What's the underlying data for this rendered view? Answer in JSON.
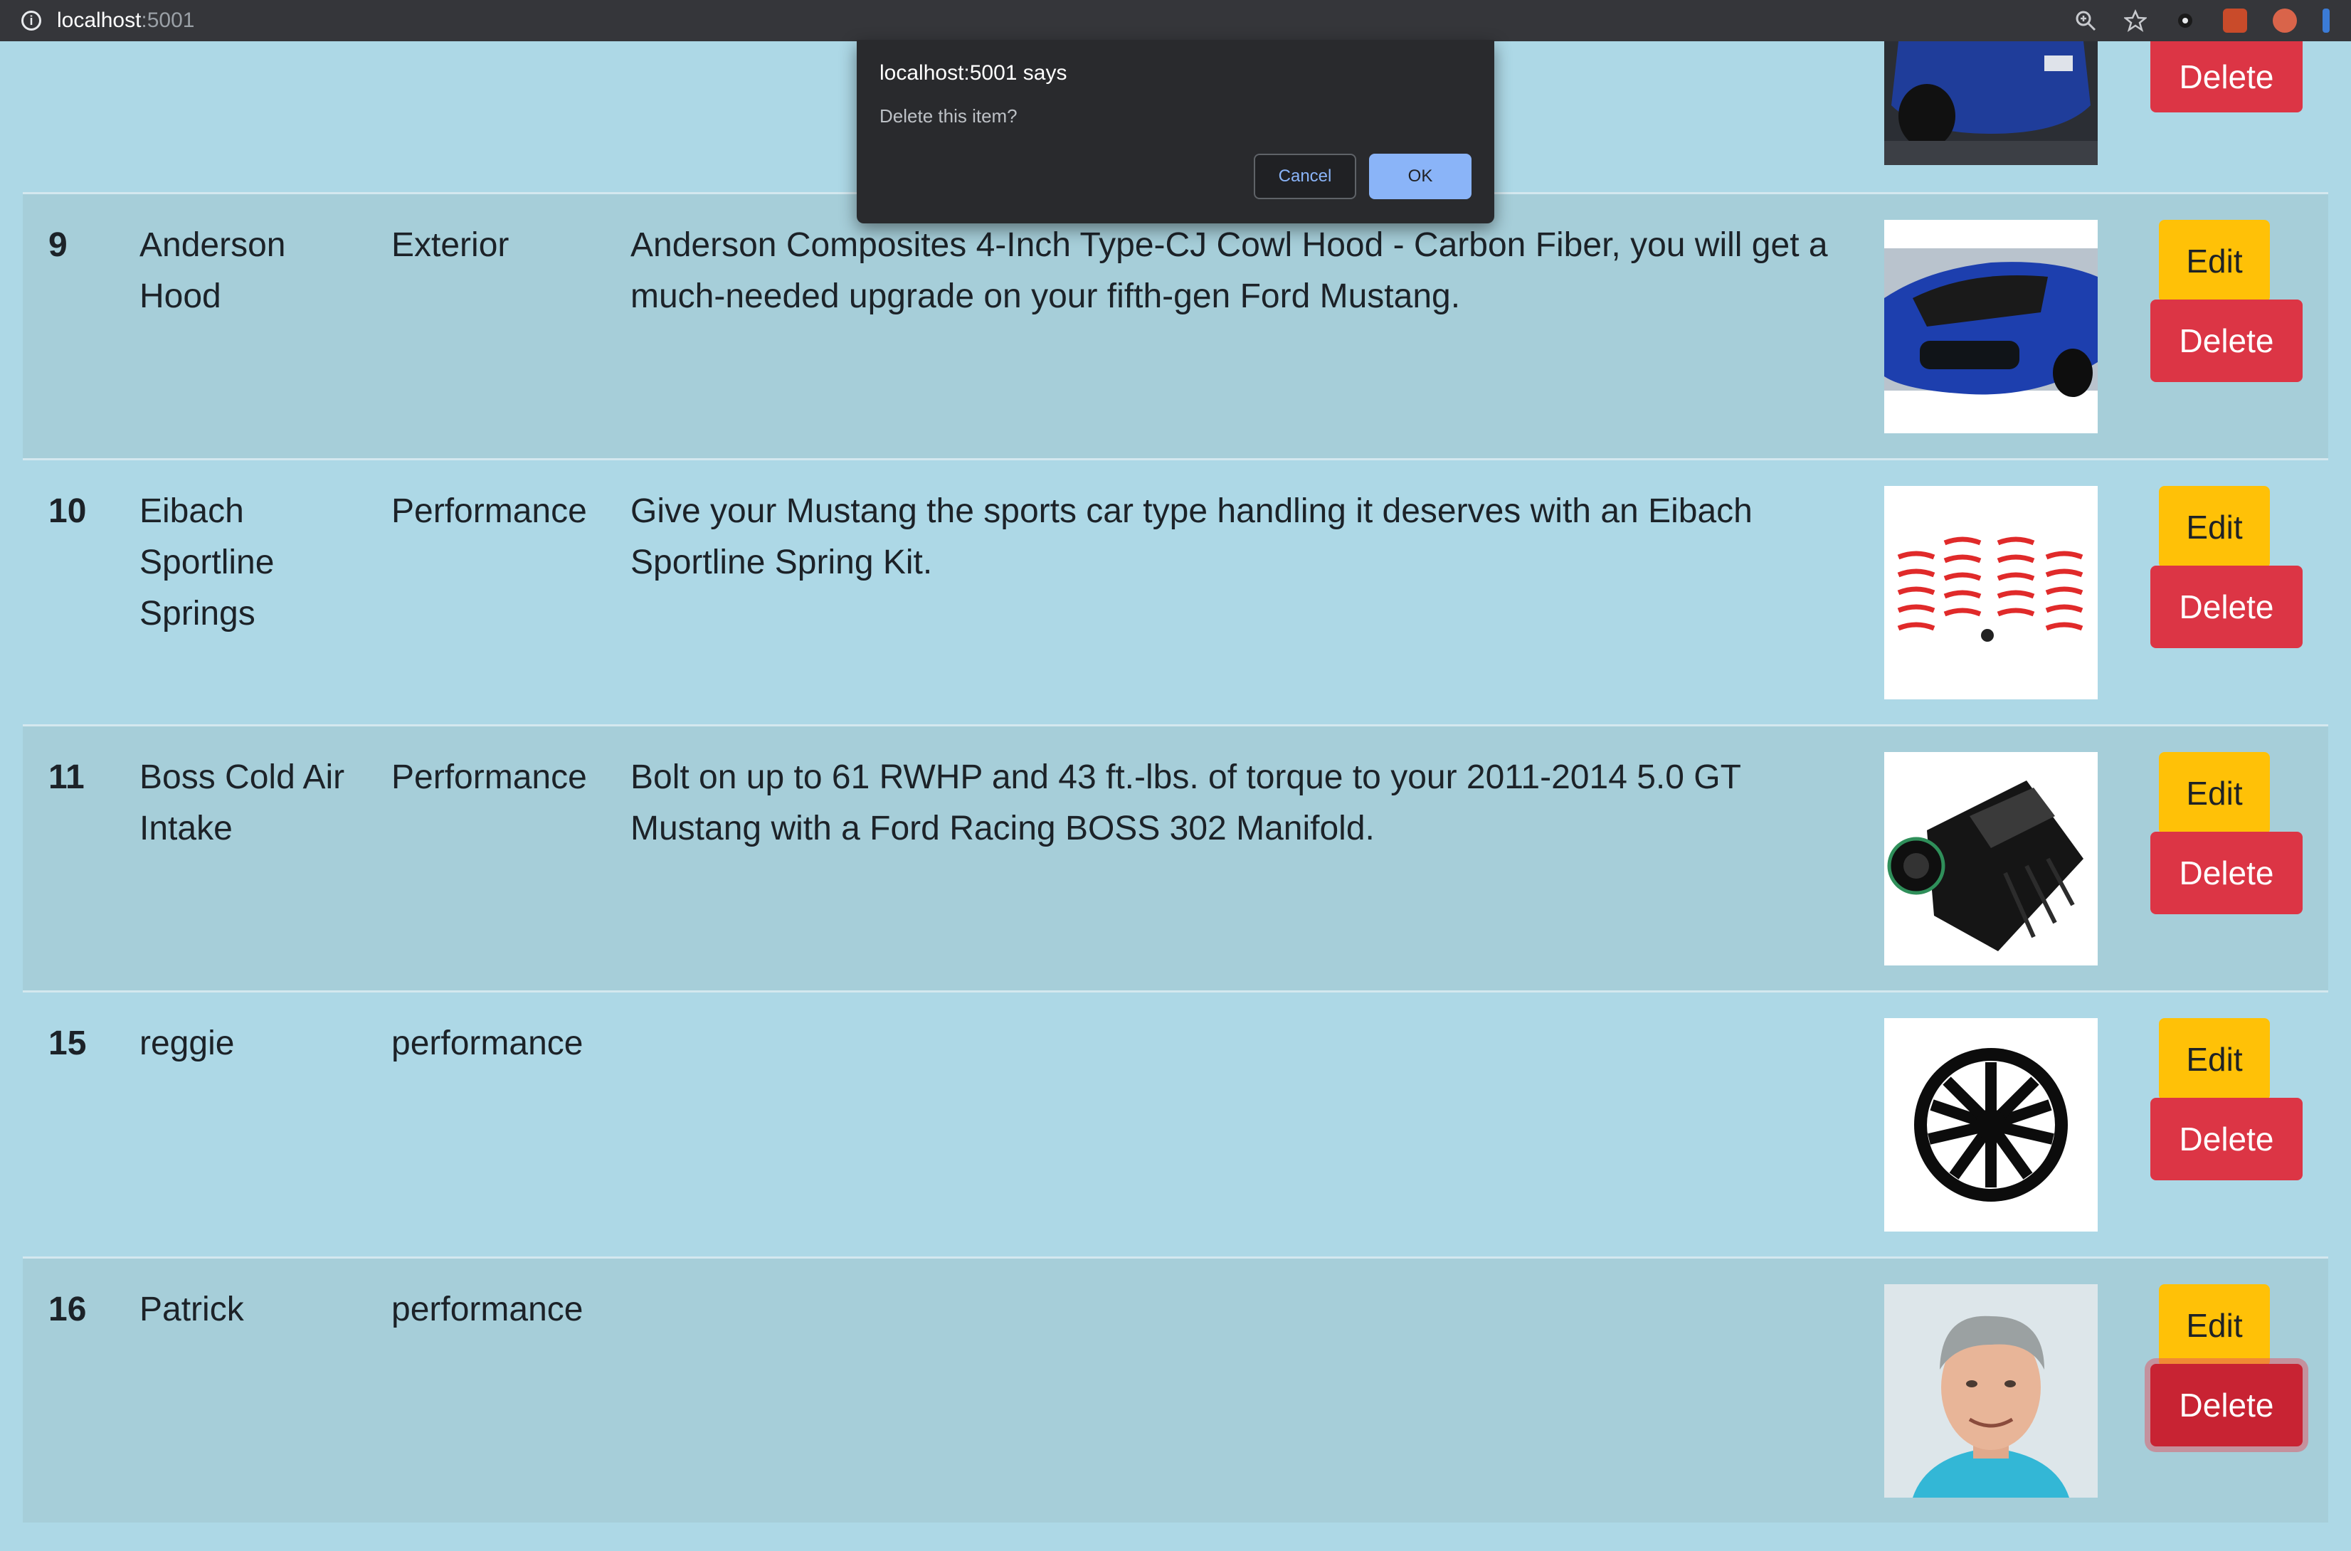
{
  "browser": {
    "url_host": "localhost",
    "url_port": ":5001",
    "icons": [
      "info-icon",
      "zoom-icon",
      "star-icon",
      "extension-icon"
    ]
  },
  "dialog": {
    "title": "localhost:5001 says",
    "message": "Delete this item?",
    "cancel_label": "Cancel",
    "ok_label": "OK"
  },
  "top_row": {
    "delete_label": "Delete"
  },
  "rows": [
    {
      "id": "9",
      "name": "Anderson Hood",
      "category": "Exterior",
      "description": "Anderson Composites 4-Inch Type-CJ Cowl Hood - Carbon Fiber, you will get a much-needed upgrade on your fifth-gen Ford Mustang.",
      "image": "blue-mustang-hood-photo",
      "edit_label": "Edit",
      "delete_label": "Delete"
    },
    {
      "id": "10",
      "name": "Eibach Sportline Springs",
      "category": "Performance",
      "description": "Give your Mustang the sports car type handling it deserves with an Eibach Sportline Spring Kit.",
      "image": "red-springs-photo",
      "edit_label": "Edit",
      "delete_label": "Delete"
    },
    {
      "id": "11",
      "name": "Boss Cold Air Intake",
      "category": "Performance",
      "description": "Bolt on up to 61 RWHP and 43 ft.-lbs. of torque to your 2011-2014 5.0 GT Mustang with a Ford Racing BOSS 302 Manifold.",
      "image": "intake-manifold-photo",
      "edit_label": "Edit",
      "delete_label": "Delete"
    },
    {
      "id": "15",
      "name": "reggie",
      "category": "performance",
      "description": "",
      "image": "black-wheel-photo",
      "edit_label": "Edit",
      "delete_label": "Delete"
    },
    {
      "id": "16",
      "name": "Patrick",
      "category": "performance",
      "description": "",
      "image": "man-portrait-photo",
      "edit_label": "Edit",
      "delete_label": "Delete"
    }
  ]
}
